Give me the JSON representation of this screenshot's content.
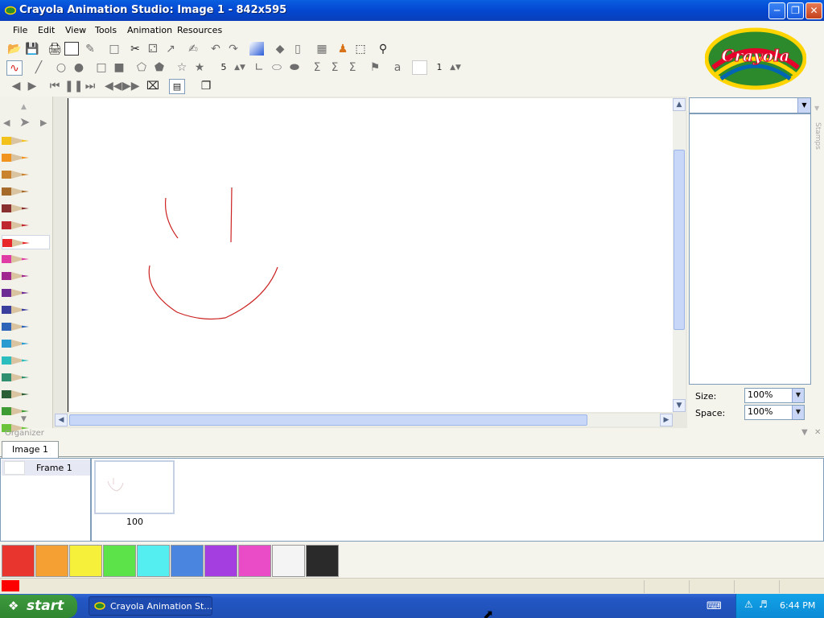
{
  "window": {
    "title": "Crayola Animation Studio: Image 1 - 842x595",
    "minimize_icon": "minimize-icon",
    "maximize_icon": "restore-icon",
    "close_icon": "close-icon"
  },
  "menu": {
    "items": [
      "File",
      "Edit",
      "View",
      "Tools",
      "Animation",
      "Resources"
    ]
  },
  "toolbar": {
    "brush_size": "5",
    "line_width": "1"
  },
  "logo": {
    "text": "Crayola",
    "colors": [
      "#ffd400",
      "#e4002b",
      "#00a650",
      "#0066b3"
    ]
  },
  "right_panel": {
    "side_tab": "Stamps",
    "size_label": "Size:",
    "size_value": "100%",
    "space_label": "Space:",
    "space_value": "100%"
  },
  "organizer": {
    "header": "Organizer",
    "tabs": [
      "Image 1"
    ],
    "frames": [
      {
        "label": "Frame 1",
        "thumb_caption": "100"
      }
    ]
  },
  "pencil_colors": [
    "#f2c21b",
    "#f0941f",
    "#c9832f",
    "#a66b2b",
    "#8a2f2f",
    "#c0282f",
    "#e8272a",
    "#e03ca6",
    "#a0278f",
    "#6d2b94",
    "#3a3f9e",
    "#2e64b8",
    "#2a9bd1",
    "#2cbdbf",
    "#2f8f6e",
    "#2c5f35",
    "#3f9b33",
    "#6cc43a"
  ],
  "palette": [
    "#e8352e",
    "#f4a033",
    "#f6f03a",
    "#5ce34a",
    "#55eef0",
    "#4a86e0",
    "#a43ee0",
    "#ea4cc8",
    "#f4f4f4",
    "#2a2a2a"
  ],
  "status": {
    "current_color": "#ff0000"
  },
  "taskbar": {
    "start_label": "start",
    "task_label": "Crayola Animation St...",
    "clock": "6:44 PM"
  }
}
